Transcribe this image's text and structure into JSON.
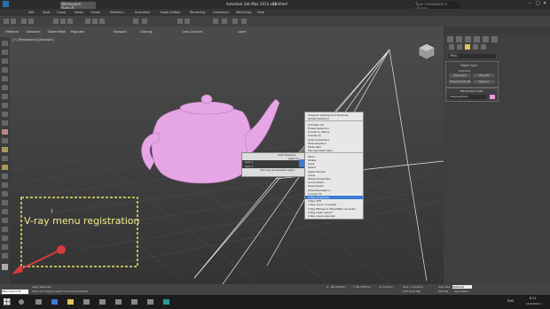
{
  "titlebar": {
    "workspace": "Workspace: Default",
    "title": "Autodesk 3ds Max 2014 x64",
    "doc": "Untitled",
    "search_placeholder": "Type a keyword or phrase"
  },
  "menubar": {
    "items": [
      "Edit",
      "Tools",
      "Group",
      "Views",
      "Create",
      "Modifiers",
      "Animation",
      "Graph Editors",
      "Rendering",
      "Customize",
      "MAXScript",
      "Help"
    ]
  },
  "ribbon": {
    "items": [
      "Freeform",
      "Selection",
      "Object Paint",
      "Populate"
    ],
    "buttons": [
      "Polygon Modeling",
      "Modify Selection",
      "Edit",
      "Geometry (All)",
      "Subdivision",
      "Align",
      "Properties"
    ]
  },
  "ribbon_row2": {
    "items": [
      "Viewport",
      "Cleanup",
      "Lens Convert",
      "Layer"
    ]
  },
  "viewport": {
    "label": "[+] [Perspective] [Realistic]"
  },
  "annotation": {
    "text": "V-ray menu registration",
    "badge": "1"
  },
  "context_menu_small": {
    "items": [
      "Cast Shadows",
      "Light On",
      "Spot 1",
      "Spot 2",
      "Set Vray as Selected Light..."
    ],
    "right_labels": [
      "Invalid",
      "Spotlight"
    ]
  },
  "context_menu_main": {
    "items": [
      "Viewport Lighting and Shadows",
      "Isolate Selection",
      "",
      "Unfreeze All",
      "Freeze Selection",
      "Unhide by Name",
      "Unhide All",
      "Hide Unselected",
      "Hide Selection",
      "State Sets",
      "Manage State Sets...",
      "",
      "Move",
      "Rotate",
      "Scale",
      "Select",
      "Select Similar",
      "Clone",
      "Object Properties...",
      "Curve Editor...",
      "Dope Sheet...",
      "Wire Parameters...",
      "Convert To:",
      "V-Ray properties",
      "V-Ray VFB",
      "V-Ray scene converter",
      "V-Ray Bitmap to VRayHDRI converter",
      "V-Ray mesh export",
      "V-Ray scene exporter"
    ],
    "highlight_index": 23
  },
  "right_panel": {
    "dropdown": "VRay",
    "section_title": "Object Type",
    "autogrid": "AutoGrid",
    "buttons": [
      "VRayLight",
      "VRayIES",
      "VRayAmbientLight",
      "VRaySun"
    ],
    "name_color": "Name and Color",
    "name_value": "VRayLight001"
  },
  "statusbar": {
    "welcome": "Welcome to M",
    "line1": "Light Selected",
    "line2": "Click and drag to select and move objects",
    "x": "X: -86,945mm",
    "y": "Y: 66,256mm",
    "z": "Z: 0,0mm",
    "grid": "Grid = 10,0mm",
    "autokey": "Auto Key",
    "selected": "Selected",
    "addtimetag": "Add Time Tag",
    "setkey": "Set Key",
    "keyfilters": "Key Filters..."
  },
  "taskbar": {
    "lang": "ENG",
    "time": "8:21",
    "date": "10.8.2014 r."
  },
  "colors": {
    "teapot": "#e6a6e6",
    "annotation_border": "#e8e26a",
    "arrow": "#d93a3a",
    "highlight": "#3a7bd5"
  }
}
